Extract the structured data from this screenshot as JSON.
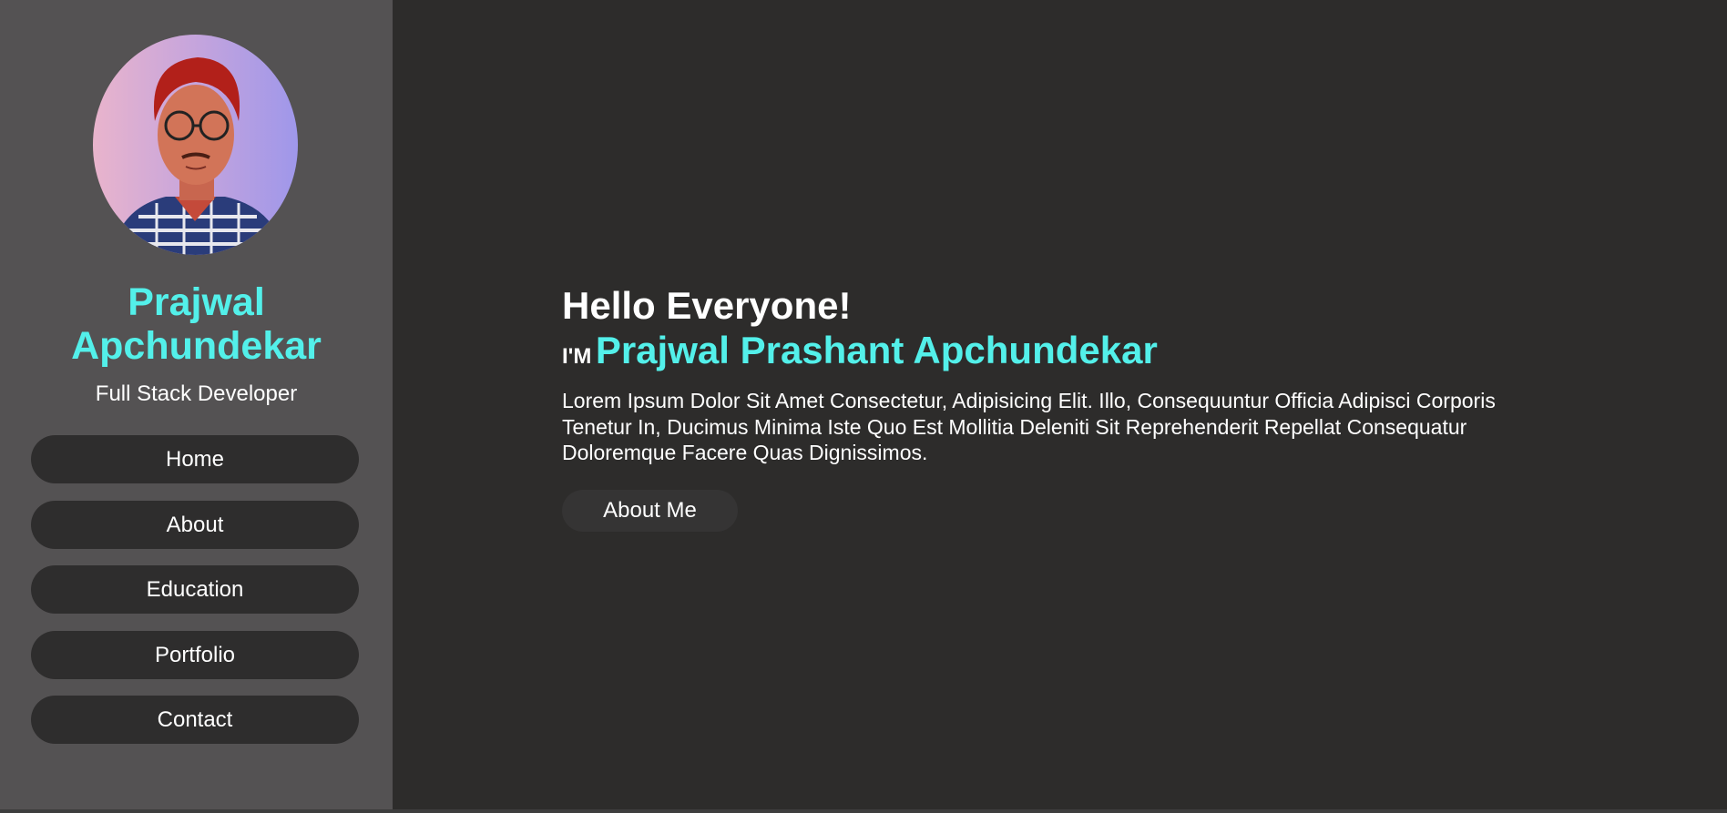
{
  "sidebar": {
    "name_line1": "Prajwal",
    "name_line2": "Apchundekar",
    "role": "Full Stack Developer",
    "nav": [
      "Home",
      "About",
      "Education",
      "Portfolio",
      "Contact"
    ]
  },
  "hero": {
    "greeting": "Hello Everyone!",
    "im_prefix": "I'M",
    "full_name": "Prajwal Prashant Apchundekar",
    "bio": "Lorem Ipsum Dolor Sit Amet Consectetur, Adipisicing Elit. Illo, Consequuntur Officia Adipisci Corporis Tenetur In, Ducimus Minima Iste Quo Est Mollitia Deleniti Sit Reprehenderit Repellat Consequatur Doloremque Facere Quas Dignissimos.",
    "about_button": "About Me"
  },
  "colors": {
    "accent": "#53f0ea",
    "sidebar_bg": "#545253",
    "main_bg": "#2d2c2b",
    "button_bg": "#2e2d2d"
  }
}
